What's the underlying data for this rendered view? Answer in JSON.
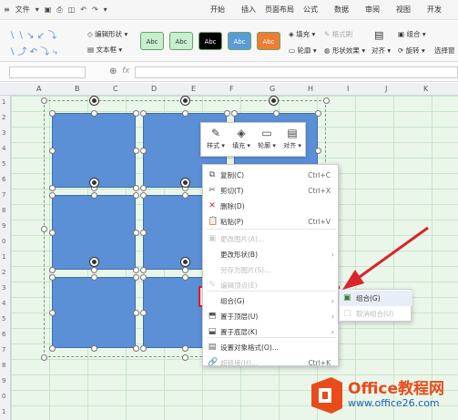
{
  "menubar": {
    "file": "文件",
    "tabs": [
      "开始",
      "插入",
      "页面布局",
      "公式",
      "数据",
      "审阅",
      "视图",
      "开发"
    ]
  },
  "ribbon": {
    "edit_shape": "编辑形状",
    "text_box": "文本框",
    "style_label": "Abc",
    "fill": "填充",
    "outline": "轮廓",
    "format_brush": "格式刷",
    "shape_effect": "形状效果",
    "align": "对齐",
    "group": "组合",
    "rotate": "旋转",
    "select_pane": "选择窗"
  },
  "swatch_colors": [
    "#c6efce",
    "#c6efce",
    "#000000",
    "#5b9bd5",
    "#ed7d31"
  ],
  "columns": [
    "A",
    "B",
    "C",
    "D",
    "E",
    "F",
    "G",
    "H",
    "I",
    "J",
    "K"
  ],
  "rows": [
    "1",
    "2",
    "3",
    "4",
    "5",
    "6",
    "7",
    "8",
    "9",
    "0",
    "1",
    "2",
    "3",
    "4",
    "5",
    "6",
    "7",
    "8",
    "9",
    "0",
    "1"
  ],
  "mini_toolbar": [
    "样式",
    "填充",
    "轮廓",
    "对齐"
  ],
  "context_menu": [
    {
      "label": "复制(C)",
      "shortcut": "Ctrl+C",
      "icon": "⧉",
      "disabled": false
    },
    {
      "label": "剪切(T)",
      "shortcut": "Ctrl+X",
      "icon": "✂",
      "disabled": false
    },
    {
      "label": "删除(D)",
      "shortcut": "",
      "icon": "✕",
      "disabled": false
    },
    {
      "label": "粘贴(P)",
      "shortcut": "Ctrl+V",
      "icon": "📋",
      "disabled": false
    },
    {
      "label": "更改图片(A)...",
      "shortcut": "",
      "icon": "▣",
      "disabled": true
    },
    {
      "label": "更改形状(B)",
      "shortcut": "",
      "icon": "",
      "disabled": false,
      "submenu": true
    },
    {
      "label": "另存为图片(S)...",
      "shortcut": "",
      "icon": "",
      "disabled": true
    },
    {
      "label": "编辑顶点(E)",
      "shortcut": "",
      "icon": "✎",
      "disabled": true
    },
    {
      "label": "组合(G)",
      "shortcut": "",
      "icon": "",
      "disabled": false,
      "submenu": true
    },
    {
      "label": "置于顶层(U)",
      "shortcut": "",
      "icon": "⬒",
      "disabled": false,
      "submenu": true
    },
    {
      "label": "置于底层(K)",
      "shortcut": "",
      "icon": "⬓",
      "disabled": false,
      "submenu": true
    },
    {
      "label": "设置对象格式(O)...",
      "shortcut": "",
      "icon": "▤",
      "disabled": false
    },
    {
      "label": "超链接(H)...",
      "shortcut": "Ctrl+K",
      "icon": "🔗",
      "disabled": true
    }
  ],
  "submenu": [
    {
      "label": "组合(G)",
      "icon": "▣",
      "disabled": false
    },
    {
      "label": "取消组合(U)",
      "icon": "▢",
      "disabled": true
    }
  ],
  "logo": {
    "title": "Office教程网",
    "url": "www.office26.com"
  }
}
